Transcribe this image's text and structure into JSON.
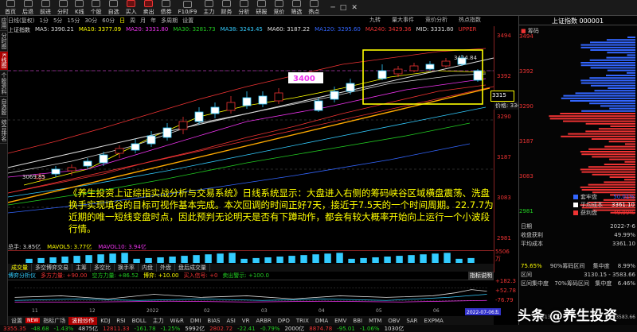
{
  "toolbar": {
    "items": [
      "首页",
      "后退",
      "前进",
      "分时",
      "K线",
      "个股",
      "自选",
      "买入",
      "卖出",
      "债券",
      "F10/F9",
      "主力",
      "财务",
      "分析",
      "研报",
      "竞价",
      "筛选",
      "热点"
    ],
    "features": [
      "九转",
      "量大事件",
      "竞价分析",
      "热点指数"
    ]
  },
  "left_tabs": [
    "应用",
    "分时图",
    "K线图",
    "个股资料",
    "自选股",
    "综合排名"
  ],
  "period_bar": {
    "items": [
      "日线(复权)",
      "1分",
      "5分",
      "15分",
      "30分",
      "60分",
      "日",
      "周",
      "月",
      "年",
      "多周期",
      "设置"
    ],
    "selected": "日"
  },
  "ma_legend": [
    {
      "label": "上证指数",
      "color": "#ddd"
    },
    {
      "label": "MA5: 3390.21",
      "color": "#ddd"
    },
    {
      "label": "MA10: 3377.09",
      "color": "#ff0"
    },
    {
      "label": "MA20: 3331.80",
      "color": "#e3e"
    },
    {
      "label": "MA30: 3281.73",
      "color": "#2c2"
    },
    {
      "label": "MA38: 3243.45",
      "color": "#3cf"
    },
    {
      "label": "MA60: 3187.22",
      "color": "#ddd"
    },
    {
      "label": "MA120: 3295.60",
      "color": "#36f"
    },
    {
      "label": "MA240: 3429.36",
      "color": "#e33"
    },
    {
      "label": "MID: 3331.80",
      "color": "#ddd"
    },
    {
      "label": "UPPER",
      "color": "#e33"
    }
  ],
  "price_axis": [
    "3494",
    "3392",
    "3290",
    "3187",
    "3083",
    "2981"
  ],
  "price_tag_left": "3315",
  "price_tooltip": "价格: 3343.43",
  "price_target_label": "3400",
  "high_label": "3424.84",
  "low_label": "3069.85",
  "annotation": "《养生投资上证综指实战分析与交易系统》日线系统显示：大盘进入右侧的筹码峡谷区域横盘震荡、洗盘换手实现填谷的目标可视作基本完成。本次回调的时间正好7天，接近于7.5天的一个时间周期。22.7.7为近期的唯一短线变盘时点，因此预判无论明天是否有下蹲动作，都会有较大概率开始向上运行一个小波段行情。",
  "volume": {
    "legend": [
      "总手: 3.85亿",
      "MAVOL5: 3.77亿",
      "MAVOL10: 3.94亿"
    ],
    "axis_value": "5506",
    "axis_unit": "万"
  },
  "indicator_tabs": [
    "成交量",
    "多空博弈交易",
    "主筹",
    "多空比",
    "换手率",
    "内盘",
    "外盘",
    "盘后成交量"
  ],
  "indicator_legend": [
    {
      "label": "博弈分析仪",
      "color": "#3cf"
    },
    {
      "label": "多方力量: +90.00",
      "color": "#e33"
    },
    {
      "label": "空方力量: +86.52",
      "color": "#2c2"
    },
    {
      "label": "博弈: +10.00",
      "color": "#ff0"
    },
    {
      "label": "买入信号: +0",
      "color": "#e33"
    },
    {
      "label": "卖出警示: +100.0",
      "color": "#2c2"
    }
  ],
  "indicator_help": "指标说明",
  "indicator_axis": [
    "+182.3",
    "+52.78",
    "-76.79"
  ],
  "x_axis": [
    "11",
    "12",
    "2022",
    "02",
    "03",
    "04",
    "05",
    "06"
  ],
  "date_badge": "2022-07-06五",
  "bottom_tabs": [
    "设置",
    "NEW",
    "指标广场",
    "波段炒作",
    "KDJ",
    "RSI",
    "BOLL",
    "主力",
    "W&R",
    "DMI",
    "BIAS",
    "ASI",
    "VR",
    "ARBR",
    "DPO",
    "TRIX",
    "DMA",
    "EMV",
    "BBI",
    "MTM",
    "OBV",
    "SAR",
    "EXPMA"
  ],
  "ticker": [
    {
      "t": "3355.35",
      "c": "r"
    },
    {
      "t": "-48.68",
      "c": "g"
    },
    {
      "t": "-1.43%",
      "c": "g"
    },
    {
      "t": "4875亿",
      "c": "w"
    },
    {
      "t": "12811.33",
      "c": "r"
    },
    {
      "t": "-161.78",
      "c": "g"
    },
    {
      "t": "-1.25%",
      "c": "g"
    },
    {
      "t": "5992亿",
      "c": "w"
    },
    {
      "t": "2802.72",
      "c": "r"
    },
    {
      "t": "-22.41",
      "c": "g"
    },
    {
      "t": "-0.79%",
      "c": "g"
    },
    {
      "t": "2000亿",
      "c": "w"
    },
    {
      "t": "8874.78",
      "c": "r"
    },
    {
      "t": "-95.01",
      "c": "g"
    },
    {
      "t": "-1.06%",
      "c": "g"
    },
    {
      "t": "1030亿",
      "c": "w"
    }
  ],
  "right_panel": {
    "title": "上证指数 000001",
    "subtitle": "筹码",
    "axis": [
      {
        "t": "3494",
        "c": "#e33"
      },
      {
        "t": "3392",
        "c": "#e33"
      },
      {
        "t": "3290",
        "c": "#e33"
      },
      {
        "t": "3187",
        "c": "#e33"
      },
      {
        "t": "3083",
        "c": "#e33"
      },
      {
        "t": "2981",
        "c": "#2c2"
      }
    ],
    "chip_legend": [
      {
        "label": "套牢盘",
        "value": "50.01%",
        "color": "#36f"
      },
      {
        "label": "平均成本",
        "value": "3361.10",
        "color": "#fff"
      },
      {
        "label": "获利盘",
        "value": "49.99%",
        "color": "#e33"
      }
    ],
    "stats": [
      {
        "k": "日期",
        "v": "2022-7-6"
      },
      {
        "k": "收盘获利",
        "v": "49.99%"
      },
      {
        "k": "平均成本",
        "v": "3361.10"
      }
    ],
    "concentration": [
      {
        "pct": "75.65%",
        "label": "90%筹码区间",
        "k": "集中度",
        "v": "8.99%"
      },
      {
        "pct": "",
        "label": "区间",
        "v": "3130.15 - 3583.66"
      },
      {
        "pct": "",
        "label": "区间集中度",
        "k2": "70%筹码区间",
        "k": "集中度",
        "v": "6.46%"
      }
    ],
    "range": [
      "3130.15",
      "3583.66"
    ]
  },
  "watermark": "头条 @养生投资"
}
